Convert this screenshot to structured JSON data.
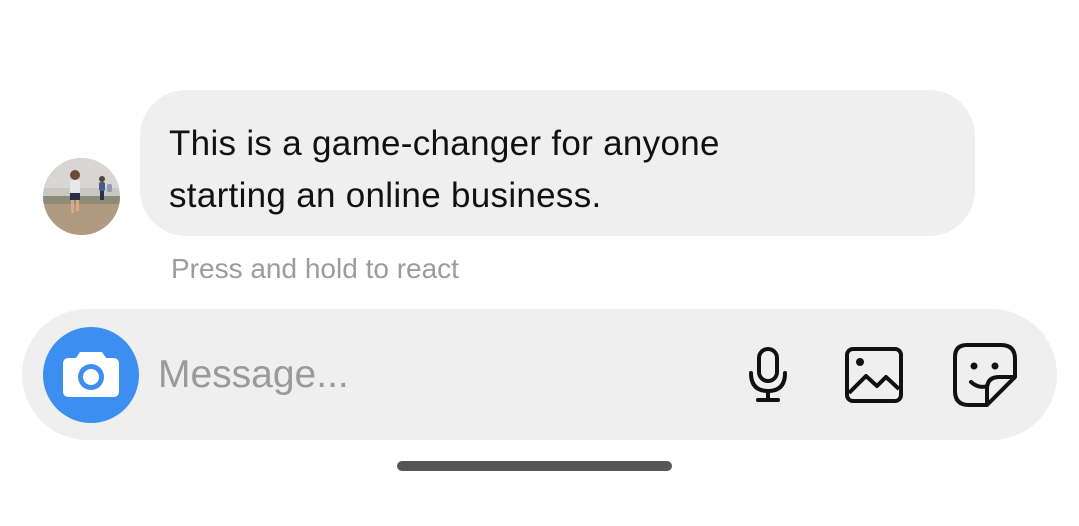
{
  "message": {
    "text_line_1": "This is a game-changer for anyone",
    "text_line_2": "starting an online business.",
    "hint": "Press and hold to react"
  },
  "composer": {
    "placeholder": "Message...",
    "camera_icon": "camera-icon",
    "mic_icon": "microphone-icon",
    "gallery_icon": "image-gallery-icon",
    "sticker_icon": "sticker-icon",
    "accent_color": "#3c8ff0"
  }
}
